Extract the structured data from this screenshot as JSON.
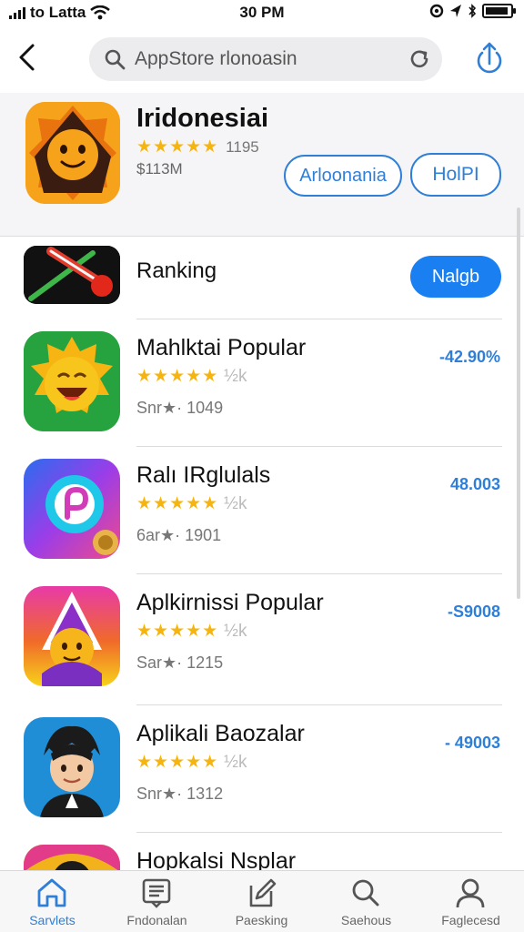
{
  "status_bar": {
    "carrier": "to Latta",
    "time": "30 PM"
  },
  "search": {
    "text": "AppStore rlonoasin"
  },
  "hero": {
    "title": "Iridonesiai",
    "rating_count": "1195",
    "size": "$113M",
    "button_1": "Arloonania",
    "button_2": "HolPI"
  },
  "ranking": {
    "label": "Ranking",
    "button": "Nalgb"
  },
  "apps": [
    {
      "title": "Mahlktai Popular",
      "meta": "Snr★· 1049",
      "price": "-42.90%",
      "stars": "★★★★★",
      "half": "½k"
    },
    {
      "title": "Ralı IRglulals",
      "meta": "6ar★· 1901",
      "price": "48.003",
      "stars": "★★★★★",
      "half": "½k"
    },
    {
      "title": "Aplkirnissi Popular",
      "meta": "Sar★· 1215",
      "price": "-S9008",
      "stars": "★★★★★",
      "half": "½k"
    },
    {
      "title": "Aplikali Baozalar",
      "meta": "Snr★· 1312",
      "price": "- 49003",
      "stars": "★★★★★",
      "half": "½k"
    },
    {
      "title": "Hopkalsi Nsplar"
    }
  ],
  "tabs": [
    {
      "label": "Sarvlets",
      "icon": "home-icon"
    },
    {
      "label": "Fndonalan",
      "icon": "news-icon"
    },
    {
      "label": "Paesking",
      "icon": "edit-icon"
    },
    {
      "label": "Saehous",
      "icon": "search-icon"
    },
    {
      "label": "Faglecesd",
      "icon": "person-icon"
    }
  ],
  "colors": {
    "accent": "#2f7fd8",
    "button_fill": "#1a7ff0",
    "star": "#f6b40e"
  }
}
